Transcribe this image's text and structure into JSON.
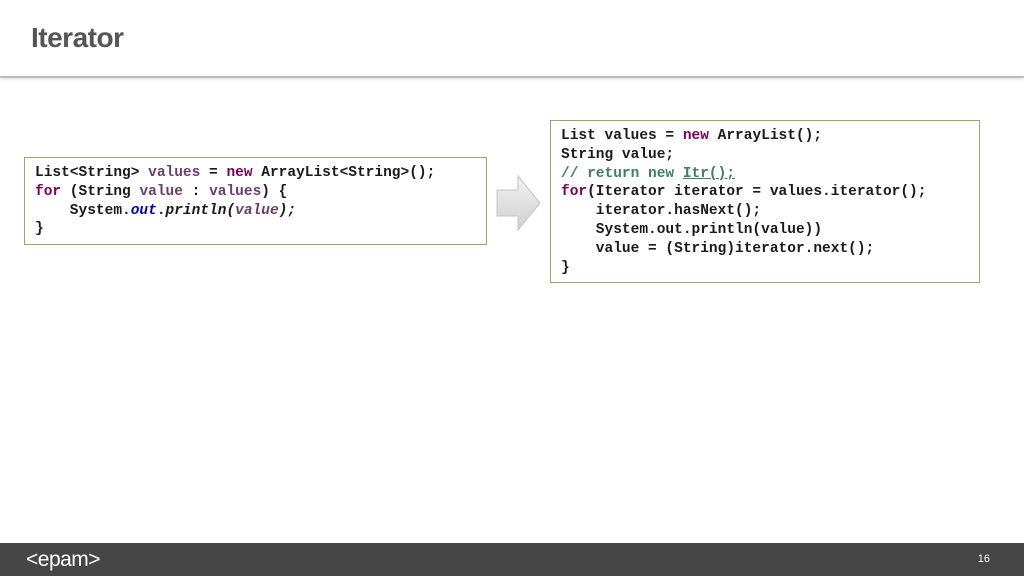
{
  "slide": {
    "title": "Iterator",
    "page_number": "16",
    "logo": "<epam>"
  },
  "code_left": {
    "line1": {
      "a": "List<String> ",
      "b": "values",
      "c": " = ",
      "d": "new",
      "e": " ArrayList<String>();"
    },
    "line2": {
      "a": "for",
      "b": " (String ",
      "c": "value",
      "d": " : ",
      "e": "values",
      "f": ") {"
    },
    "line3": {
      "a": "    System.",
      "b": "out",
      "c": ".",
      "d": "println(",
      "e": "value",
      "f": ");"
    },
    "line4": {
      "a": "}"
    }
  },
  "code_right": {
    "line1": {
      "a": "List values = ",
      "b": "new",
      "c": " ArrayList();"
    },
    "line2": {
      "a": "String value;"
    },
    "line3": {
      "a": "// return new ",
      "b": "Itr();"
    },
    "line4": {
      "a": "for",
      "b": "(Iterator iterator = values.iterator();"
    },
    "line5": {
      "a": "    iterator.hasNext();"
    },
    "line6": {
      "a": "    System.out.println(value))"
    },
    "line7": {
      "a": "    value = (String)iterator.next();"
    },
    "line8": {
      "a": "}"
    }
  },
  "colors": {
    "keyword": "#7f0055",
    "variable": "#6a3e6a",
    "field": "#0000c0",
    "comment": "#3f7f5f",
    "box_border": "#9aa96a",
    "footer": "#464646"
  },
  "icons": {
    "arrow": "arrow-right-icon"
  }
}
